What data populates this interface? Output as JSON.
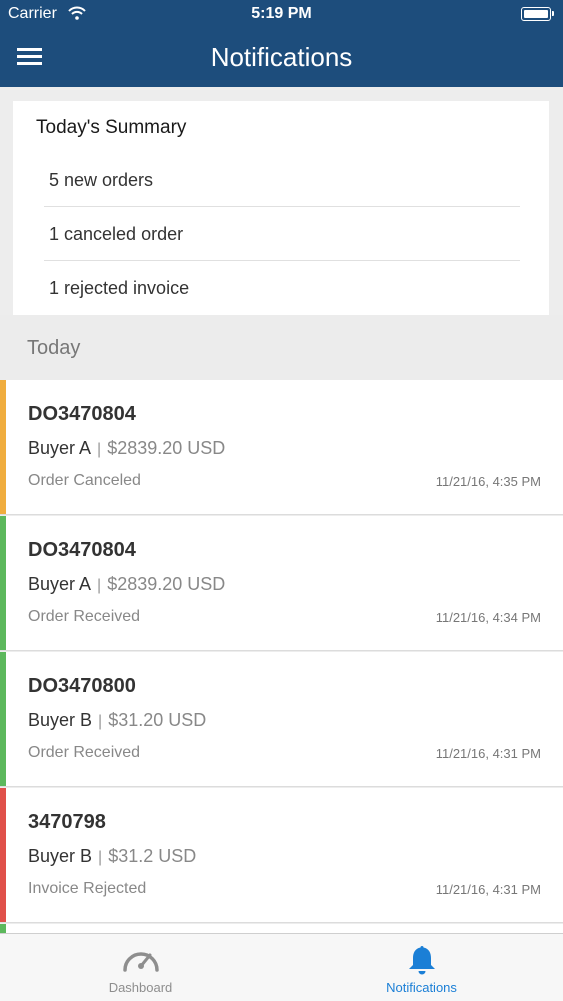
{
  "status_bar": {
    "carrier": "Carrier",
    "time": "5:19 PM"
  },
  "header": {
    "title": "Notifications",
    "menu_icon": "hamburger-menu-icon"
  },
  "summary": {
    "title": "Today's Summary",
    "items": [
      "5 new orders",
      "1 canceled order",
      "1 rejected invoice"
    ]
  },
  "section": {
    "label": "Today"
  },
  "notifications": [
    {
      "order_id": "DO3470804",
      "buyer": "Buyer A",
      "amount": "$2839.20 USD",
      "status": "Order Canceled",
      "timestamp": "11/21/16, 4:35 PM",
      "accent": "#f0ad3e"
    },
    {
      "order_id": "DO3470804",
      "buyer": "Buyer A",
      "amount": "$2839.20 USD",
      "status": "Order Received",
      "timestamp": "11/21/16, 4:34 PM",
      "accent": "#5cb85c"
    },
    {
      "order_id": "DO3470800",
      "buyer": "Buyer B",
      "amount": "$31.20 USD",
      "status": "Order Received",
      "timestamp": "11/21/16, 4:31 PM",
      "accent": "#5cb85c"
    },
    {
      "order_id": "3470798",
      "buyer": "Buyer B",
      "amount": "$31.2 USD",
      "status": "Invoice Rejected",
      "timestamp": "11/21/16, 4:31 PM",
      "accent": "#e0504a"
    }
  ],
  "peek_accent": "#5cb85c",
  "tab_bar": {
    "tabs": [
      {
        "label": "Dashboard",
        "icon": "speedometer-icon",
        "active": false
      },
      {
        "label": "Notifications",
        "icon": "bell-icon",
        "active": true
      }
    ],
    "active_color": "#1b7fd6",
    "inactive_color": "#8e8e8e"
  },
  "colors": {
    "header_bg": "#1d4d7c",
    "background": "#ededed"
  }
}
